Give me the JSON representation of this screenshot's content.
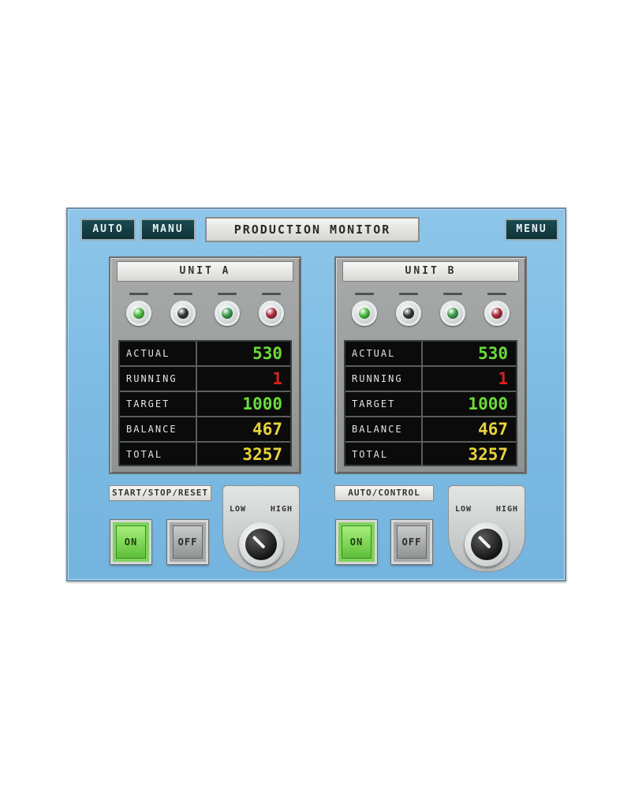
{
  "header": {
    "tag_left_1": "AUTO",
    "tag_left_2": "MANU",
    "title": "PRODUCTION MONITOR",
    "tag_right": "MENU"
  },
  "units": [
    {
      "title": "UNIT A",
      "lamps": [
        {
          "color": "#46b83a",
          "icon": "green-indicator"
        },
        {
          "color": "#2f3535",
          "icon": "dark-indicator"
        },
        {
          "color": "#3a9a4a",
          "icon": "green-indicator"
        },
        {
          "color": "#a8283a",
          "icon": "red-indicator"
        }
      ],
      "rows": [
        {
          "label": "ACTUAL",
          "value": "530",
          "color": "#6bdc3a"
        },
        {
          "label": "RUNNING",
          "value": "1",
          "color": "#d82020"
        },
        {
          "label": "TARGET",
          "value": "1000",
          "color": "#6bdc3a"
        },
        {
          "label": "BALANCE",
          "value": "467",
          "color": "#e6d43a"
        },
        {
          "label": "TOTAL",
          "value": "3257",
          "color": "#e6d43a"
        }
      ],
      "mode_label": "START/STOP/RESET",
      "buttons": [
        {
          "label": "ON",
          "style": "green"
        },
        {
          "label": "OFF",
          "style": "grey"
        }
      ],
      "selector": {
        "left": "LOW",
        "right": "HIGH"
      }
    },
    {
      "title": "UNIT B",
      "lamps": [
        {
          "color": "#46b83a",
          "icon": "green-indicator"
        },
        {
          "color": "#2f3535",
          "icon": "dark-indicator"
        },
        {
          "color": "#3a9a4a",
          "icon": "green-indicator"
        },
        {
          "color": "#a8283a",
          "icon": "red-indicator"
        }
      ],
      "rows": [
        {
          "label": "ACTUAL",
          "value": "530",
          "color": "#6bdc3a"
        },
        {
          "label": "RUNNING",
          "value": "1",
          "color": "#d82020"
        },
        {
          "label": "TARGET",
          "value": "1000",
          "color": "#6bdc3a"
        },
        {
          "label": "BALANCE",
          "value": "467",
          "color": "#e6d43a"
        },
        {
          "label": "TOTAL",
          "value": "3257",
          "color": "#e6d43a"
        }
      ],
      "mode_label": "AUTO/CONTROL",
      "buttons": [
        {
          "label": "ON",
          "style": "green"
        },
        {
          "label": "OFF",
          "style": "grey"
        }
      ],
      "selector": {
        "left": "LOW",
        "right": "HIGH"
      }
    }
  ]
}
